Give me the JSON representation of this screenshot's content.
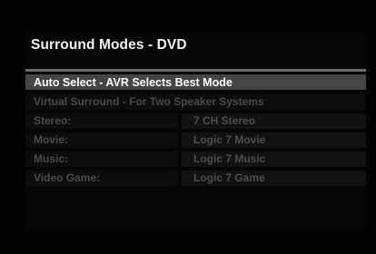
{
  "screen": {
    "title": "Surround Modes - DVD",
    "selected_option": "Auto Select - AVR Selects Best Mode",
    "option_virtual": "Virtual Surround - For Two Speaker Systems",
    "rows": [
      {
        "label": "Stereo:",
        "value": "7 CH Stereo"
      },
      {
        "label": "Movie:",
        "value": "Logic 7 Movie"
      },
      {
        "label": "Music:",
        "value": "Logic 7 Music"
      },
      {
        "label": "Video Game:",
        "value": "Logic 7 Game"
      }
    ]
  },
  "colors": {
    "background": "#000000",
    "highlight": "#454545",
    "separator": "#6b6b6b",
    "inactive_text": "#4a4a4a"
  }
}
